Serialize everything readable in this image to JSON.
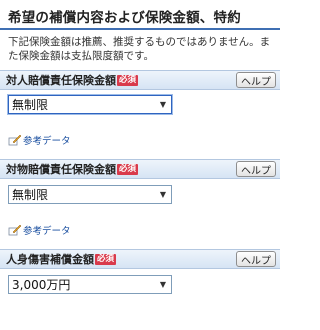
{
  "page_title": "希望の補償内容および保険金額、特約",
  "description": "下記保険金額は推薦、推奨するものではありません。また保険金額は支払限度額です。",
  "required_badge": "必須",
  "help_label": "ヘルプ",
  "reference_link": "参考データ",
  "sections": [
    {
      "label": "対人賠償責任保険金額",
      "selected": "無制限"
    },
    {
      "label": "対物賠償責任保険金額",
      "selected": "無制限"
    },
    {
      "label": "人身傷害補償金額",
      "selected": "3,000万円"
    }
  ],
  "colors": {
    "accent_blue": "#3f6fb3",
    "required_red": "#d93a4b",
    "link_blue": "#1a4fa0"
  }
}
